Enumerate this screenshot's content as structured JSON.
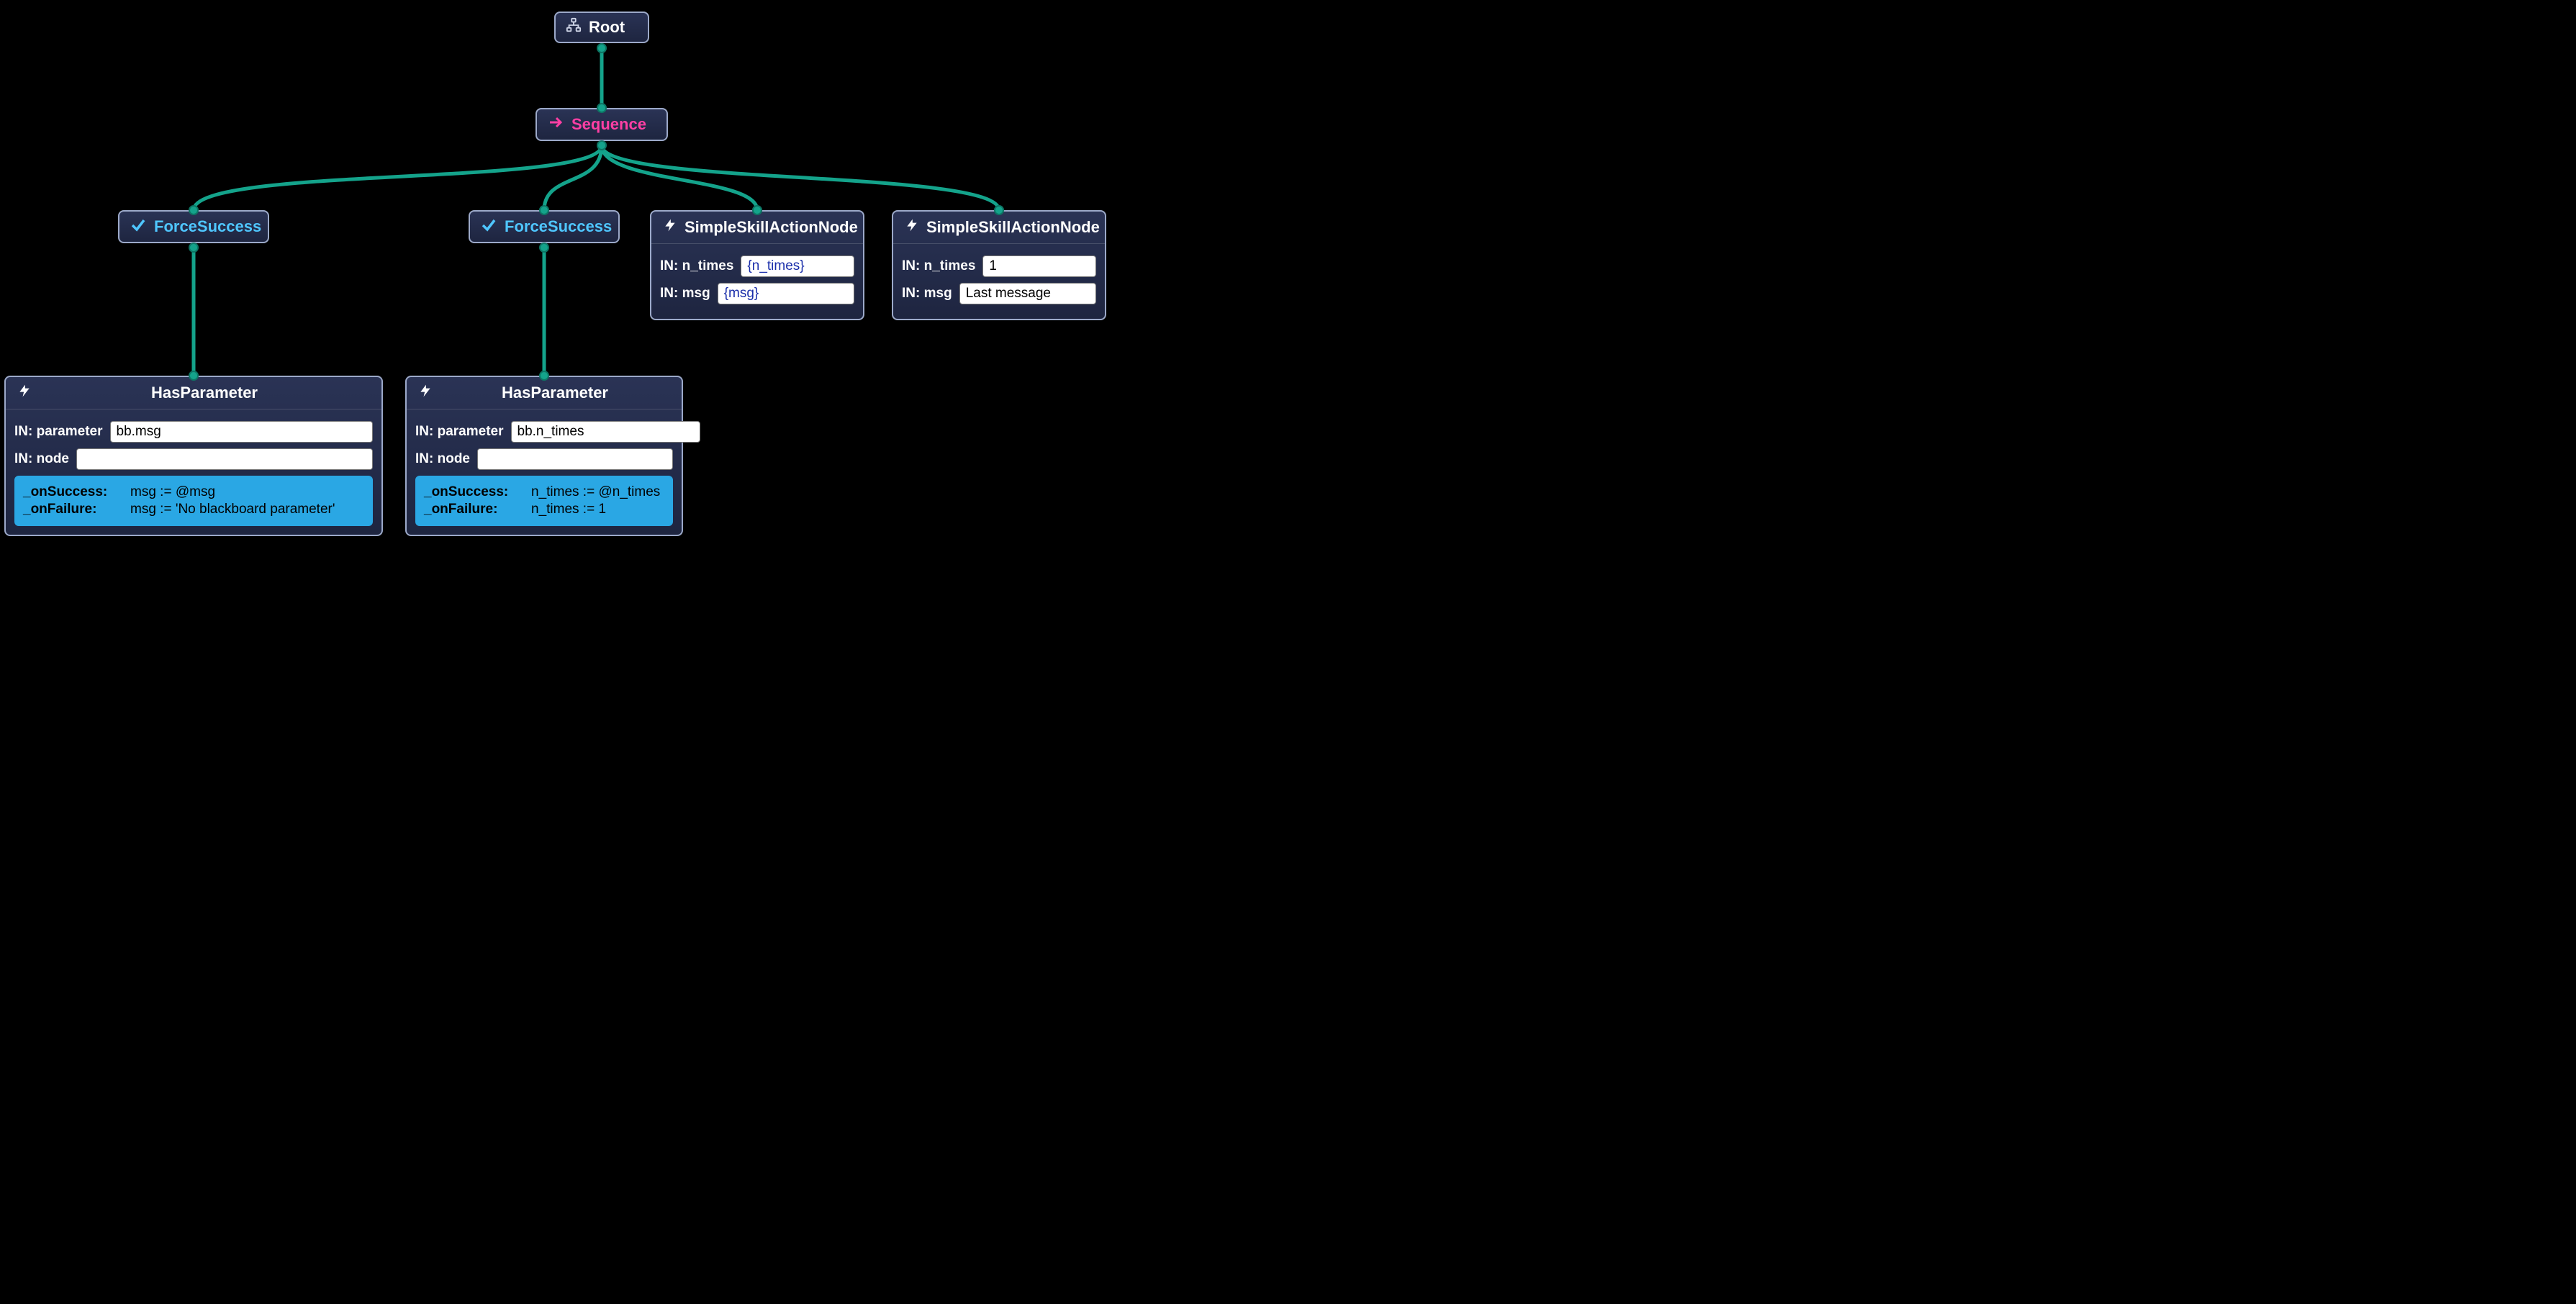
{
  "colors": {
    "edge": "#14a38b",
    "node_bg_top": "#2a3355",
    "node_bg_bottom": "#1e2540",
    "node_border": "#9ca9c9",
    "callback_bg": "#2aa7e4",
    "seq": "#ff3fa4",
    "force_success": "#4fc6ff"
  },
  "root": {
    "title": "Root"
  },
  "sequence": {
    "title": "Sequence"
  },
  "fs1": {
    "title": "ForceSuccess"
  },
  "fs2": {
    "title": "ForceSuccess"
  },
  "action1": {
    "title": "SimpleSkillActionNode",
    "port_prefix": "IN:",
    "ports": {
      "n_times": {
        "label": "n_times",
        "value": "{n_times}",
        "is_var": true
      },
      "msg": {
        "label": "msg",
        "value": "{msg}",
        "is_var": true
      }
    }
  },
  "action2": {
    "title": "SimpleSkillActionNode",
    "port_prefix": "IN:",
    "ports": {
      "n_times": {
        "label": "n_times",
        "value": "1",
        "is_var": false
      },
      "msg": {
        "label": "msg",
        "value": "Last message",
        "is_var": false
      }
    }
  },
  "hp1": {
    "title": "HasParameter",
    "port_prefix": "IN:",
    "ports": {
      "parameter": {
        "label": "parameter",
        "value": "bb.msg"
      },
      "node": {
        "label": "node",
        "value": ""
      }
    },
    "callbacks": {
      "onSuccess": {
        "key": "_onSuccess:",
        "value": "msg := @msg"
      },
      "onFailure": {
        "key": "_onFailure:",
        "value": "msg := 'No blackboard parameter'"
      }
    }
  },
  "hp2": {
    "title": "HasParameter",
    "port_prefix": "IN:",
    "ports": {
      "parameter": {
        "label": "parameter",
        "value": "bb.n_times"
      },
      "node": {
        "label": "node",
        "value": ""
      }
    },
    "callbacks": {
      "onSuccess": {
        "key": "_onSuccess:",
        "value": "n_times := @n_times"
      },
      "onFailure": {
        "key": "_onFailure:",
        "value": "n_times := 1"
      }
    }
  }
}
